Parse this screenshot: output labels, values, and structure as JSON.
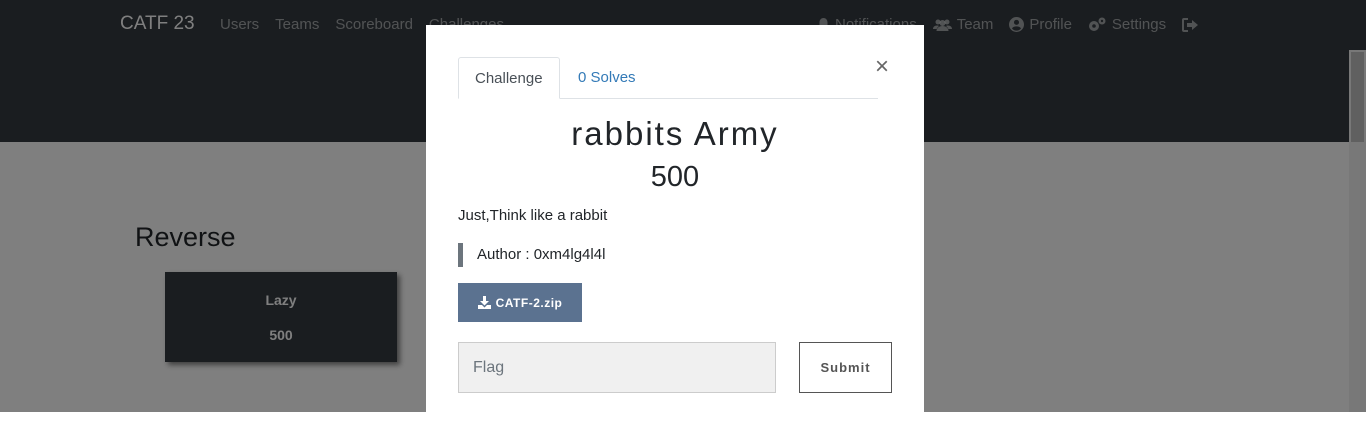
{
  "navbar": {
    "brand": "CATF 23",
    "left_links": [
      "Users",
      "Teams",
      "Scoreboard",
      "Challenges"
    ],
    "right_links": [
      {
        "icon": "bell-icon",
        "label": "Notifications"
      },
      {
        "icon": "users-icon",
        "label": "Team"
      },
      {
        "icon": "user-circle-icon",
        "label": "Profile"
      },
      {
        "icon": "cogs-icon",
        "label": "Settings"
      },
      {
        "icon": "sign-out-icon",
        "label": ""
      }
    ]
  },
  "board": {
    "category": "Reverse",
    "challenges": [
      {
        "name": "Lazy",
        "value": "500"
      }
    ]
  },
  "modal": {
    "tabs": [
      "Challenge",
      "0 Solves"
    ],
    "close_label": "×",
    "title": "rabbits Army",
    "value": "500",
    "description": "Just,Think like a rabbit",
    "author": "Author : 0xm4lg4l4l",
    "file_button": "CATF-2.zip",
    "flag_placeholder": "Flag",
    "submit_label": "Submit"
  },
  "colors": {
    "navbar_bg": "#343a40",
    "download_button": "#5b7290",
    "tab_link": "#337ab7"
  }
}
